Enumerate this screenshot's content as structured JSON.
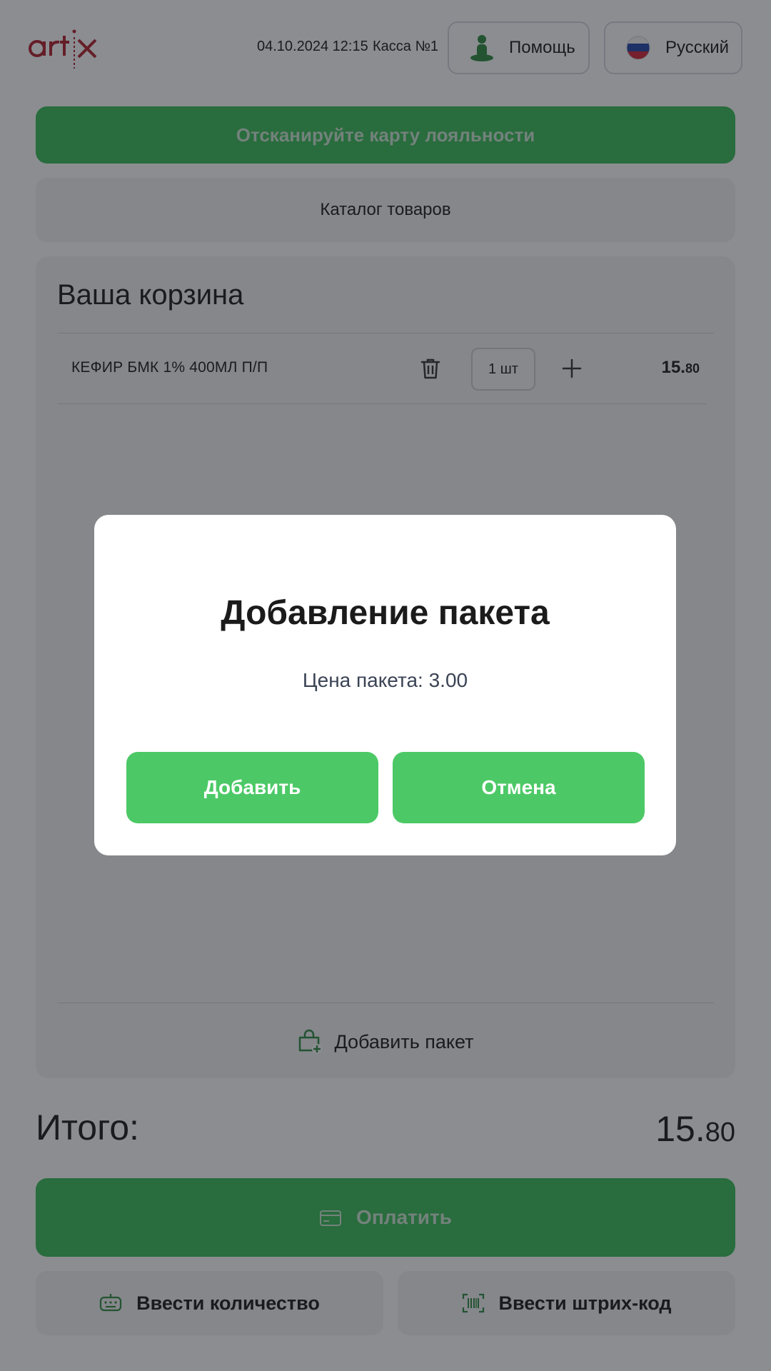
{
  "header": {
    "logo_text": "artix",
    "datetime": "04.10.2024 12:15",
    "register": "Касса №1",
    "help_label": "Помощь",
    "language_label": "Русский"
  },
  "loyalty_button": {
    "label": "Отсканируйте карту лояльности"
  },
  "catalog_button": {
    "label": "Каталог товаров"
  },
  "cart": {
    "title": "Ваша корзина",
    "items": [
      {
        "name": "КЕФИР БМК 1% 400МЛ П/П",
        "quantity": "1 шт",
        "price_main": "15.",
        "price_cents": "80"
      }
    ],
    "add_bag_label": "Добавить пакет"
  },
  "total": {
    "label": "Итого:",
    "value_main": "15.",
    "value_cents": "80"
  },
  "pay_button": {
    "label": "Оплатить"
  },
  "enter_quantity_button": {
    "label": "Ввести количество"
  },
  "enter_barcode_button": {
    "label": "Ввести штрих-код"
  },
  "modal": {
    "title": "Добавление пакета",
    "price_text": "Цена пакета: 3.00",
    "confirm_label": "Добавить",
    "cancel_label": "Отмена"
  },
  "colors": {
    "accent_green": "#3bbd56",
    "modal_button_green": "#4cc966",
    "logo_red": "#b3202c",
    "icon_green": "#2e8b3e"
  },
  "icons": {
    "help": "person-help-icon",
    "language": "russia-flag-icon",
    "delete": "trash-icon",
    "increase": "plus-icon",
    "bag": "shopping-bag-plus-icon",
    "pay": "credit-card-icon",
    "keypad": "keypad-icon",
    "barcode": "barcode-scan-icon"
  }
}
